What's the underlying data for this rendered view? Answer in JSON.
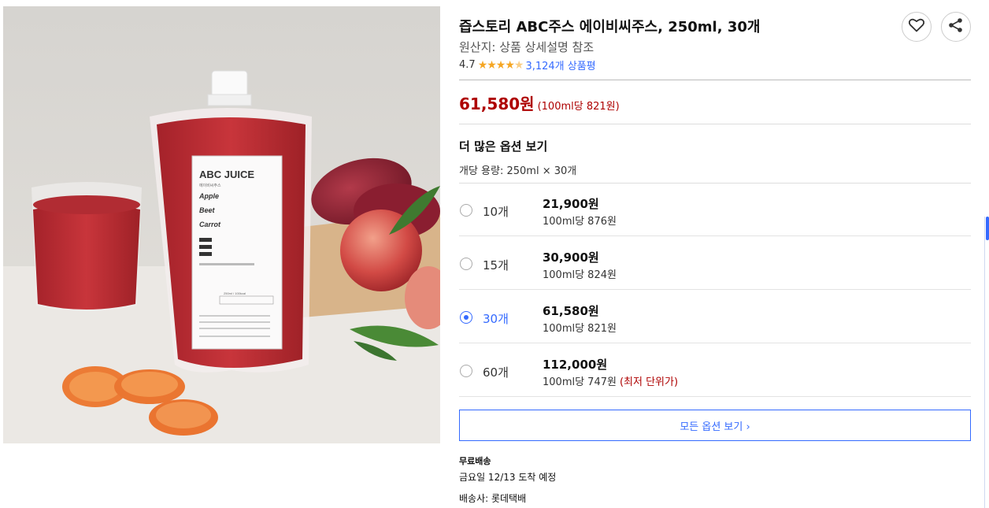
{
  "product": {
    "title": "즙스토리 ABC주스 에이비씨주스, 250ml, 30개",
    "origin": "원산지: 상품 상세설명 참조",
    "rating_value": "4.7",
    "rating_stars": 4.5,
    "review_count": "3,124개 상품평",
    "price": "61,580원",
    "unit_price": "(100ml당 821원)"
  },
  "image": {
    "label_title": "ABC JUICE",
    "label_sub": "에이비씨주스",
    "label_line1": "Apple",
    "label_line2": "Beet",
    "label_line3": "Carrot",
    "label_volume": "250ml / 100kcal"
  },
  "options": {
    "heading": "더 많은 옵션 보기",
    "volume": "개당 용량: 250ml × 30개",
    "items": [
      {
        "qty": "10개",
        "price": "21,900원",
        "unit": "100ml당 876원",
        "note": "",
        "selected": false
      },
      {
        "qty": "15개",
        "price": "30,900원",
        "unit": "100ml당 824원",
        "note": "",
        "selected": false
      },
      {
        "qty": "30개",
        "price": "61,580원",
        "unit": "100ml당 821원",
        "note": "",
        "selected": true
      },
      {
        "qty": "60개",
        "price": "112,000원",
        "unit": "100ml당 747원",
        "note": "(최저 단위가)",
        "selected": false
      }
    ],
    "all_button": "모든 옵션 보기 ›"
  },
  "shipping": {
    "type": "무료배송",
    "arrival": "금요일 12/13 도착 예정",
    "carrier": "배송사: 롯데택배"
  },
  "colors": {
    "accent": "#346aff",
    "price": "#ae0000",
    "star": "#f5a623"
  },
  "icons": [
    "heart-icon",
    "share-icon",
    "star-icon",
    "chevron-right-icon"
  ]
}
